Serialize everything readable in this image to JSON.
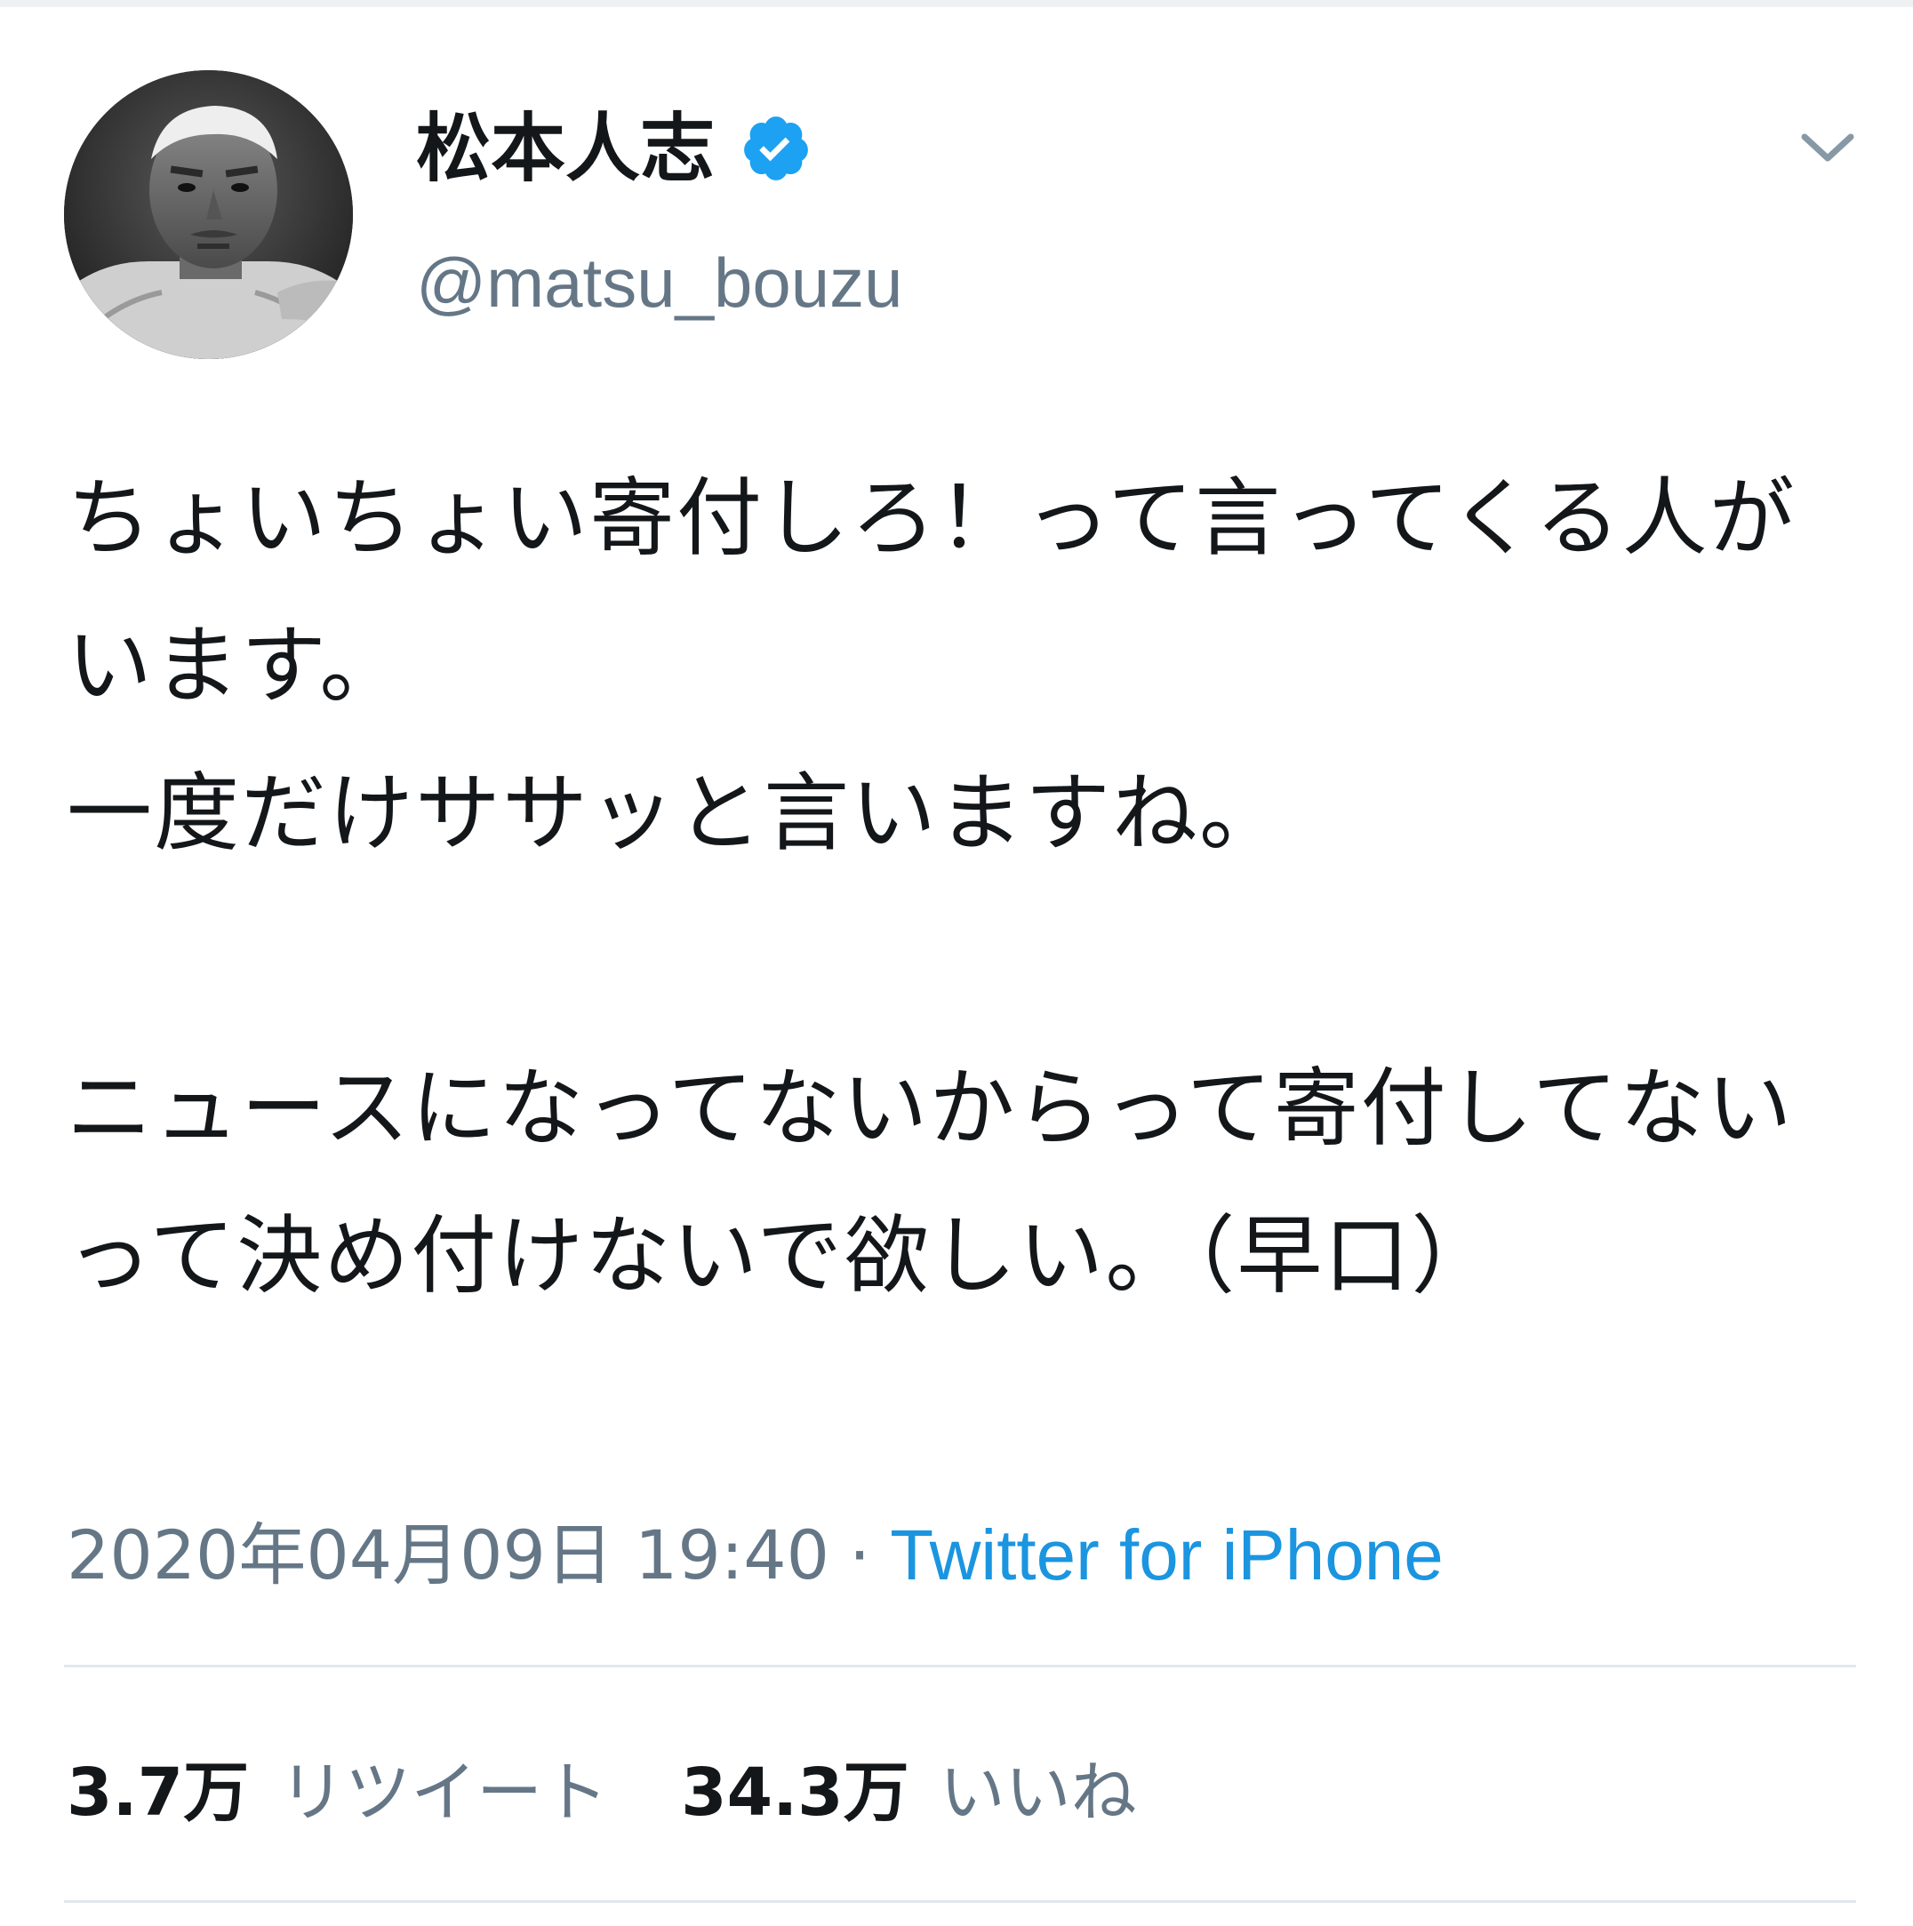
{
  "tweet": {
    "author": {
      "display_name": "松本人志",
      "handle": "@matsu_bouzu",
      "verified": true,
      "avatar_icon": "user-avatar-photo"
    },
    "text": "ちょいちょい寄付しろ！って言ってくる人がいます。\n一度だけササッと言いますね。\n\nニュースになってないからって寄付してないって決め付けないで欲しい。（早口）",
    "timestamp": "2020年04月09日 19:40",
    "separator": "·",
    "source": "Twitter for iPhone",
    "stats": {
      "retweets_count": "3.7万",
      "retweets_label": "リツイート",
      "likes_count": "34.3万",
      "likes_label": "いいね"
    }
  },
  "colors": {
    "text_primary": "#14171a",
    "text_secondary": "#657786",
    "link_blue": "#1b95e0",
    "verified_blue": "#1da1f2",
    "divider": "#e1e8ed"
  },
  "icons": {
    "verified": "verified-badge-icon",
    "more": "chevron-down-icon"
  }
}
